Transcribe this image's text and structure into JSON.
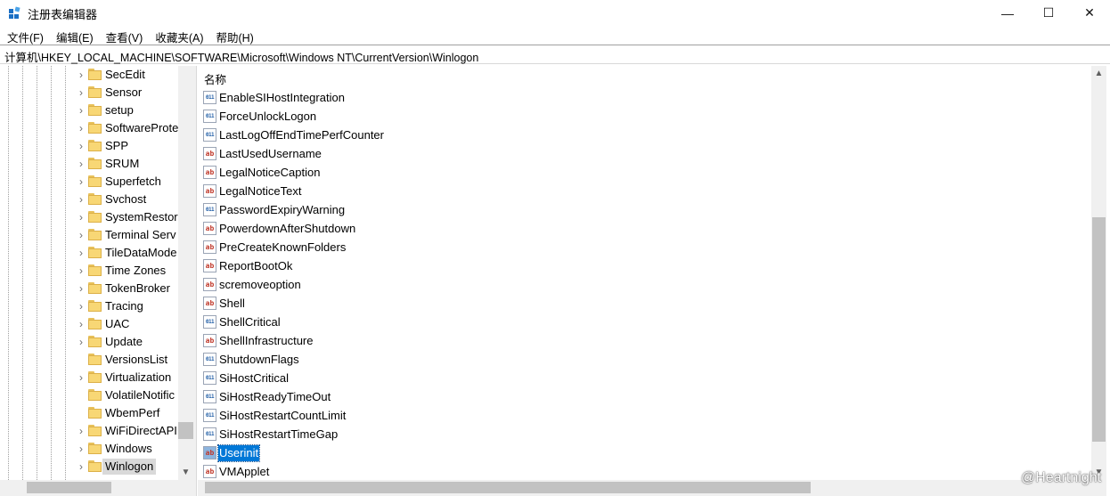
{
  "window": {
    "title": "注册表编辑器",
    "minimize": "—",
    "maximize": "☐",
    "close": "✕"
  },
  "menu": [
    "文件(F)",
    "编辑(E)",
    "查看(V)",
    "收藏夹(A)",
    "帮助(H)"
  ],
  "address": "计算机\\HKEY_LOCAL_MACHINE\\SOFTWARE\\Microsoft\\Windows NT\\CurrentVersion\\Winlogon",
  "tree": {
    "items": [
      {
        "label": "SecEdit",
        "expandable": true
      },
      {
        "label": "Sensor",
        "expandable": true
      },
      {
        "label": "setup",
        "expandable": true
      },
      {
        "label": "SoftwareProte",
        "expandable": true
      },
      {
        "label": "SPP",
        "expandable": true
      },
      {
        "label": "SRUM",
        "expandable": true
      },
      {
        "label": "Superfetch",
        "expandable": true
      },
      {
        "label": "Svchost",
        "expandable": true
      },
      {
        "label": "SystemRestor",
        "expandable": true
      },
      {
        "label": "Terminal Serv",
        "expandable": true
      },
      {
        "label": "TileDataMode",
        "expandable": true
      },
      {
        "label": "Time Zones",
        "expandable": true
      },
      {
        "label": "TokenBroker",
        "expandable": true
      },
      {
        "label": "Tracing",
        "expandable": true
      },
      {
        "label": "UAC",
        "expandable": true
      },
      {
        "label": "Update",
        "expandable": true
      },
      {
        "label": "VersionsList",
        "expandable": false
      },
      {
        "label": "Virtualization",
        "expandable": true
      },
      {
        "label": "VolatileNotific",
        "expandable": false
      },
      {
        "label": "WbemPerf",
        "expandable": false
      },
      {
        "label": "WiFiDirectAPI",
        "expandable": true
      },
      {
        "label": "Windows",
        "expandable": true
      },
      {
        "label": "Winlogon",
        "expandable": true,
        "selected": true
      }
    ],
    "chevron": "›"
  },
  "values": {
    "column_name": "名称",
    "rows": [
      {
        "name": "EnableSIHostIntegration",
        "type": "dword"
      },
      {
        "name": "ForceUnlockLogon",
        "type": "dword"
      },
      {
        "name": "LastLogOffEndTimePerfCounter",
        "type": "dword"
      },
      {
        "name": "LastUsedUsername",
        "type": "sz"
      },
      {
        "name": "LegalNoticeCaption",
        "type": "sz"
      },
      {
        "name": "LegalNoticeText",
        "type": "sz"
      },
      {
        "name": "PasswordExpiryWarning",
        "type": "dword"
      },
      {
        "name": "PowerdownAfterShutdown",
        "type": "sz"
      },
      {
        "name": "PreCreateKnownFolders",
        "type": "sz"
      },
      {
        "name": "ReportBootOk",
        "type": "sz"
      },
      {
        "name": "scremoveoption",
        "type": "sz"
      },
      {
        "name": "Shell",
        "type": "sz"
      },
      {
        "name": "ShellCritical",
        "type": "dword"
      },
      {
        "name": "ShellInfrastructure",
        "type": "sz"
      },
      {
        "name": "ShutdownFlags",
        "type": "dword"
      },
      {
        "name": "SiHostCritical",
        "type": "dword"
      },
      {
        "name": "SiHostReadyTimeOut",
        "type": "dword"
      },
      {
        "name": "SiHostRestartCountLimit",
        "type": "dword"
      },
      {
        "name": "SiHostRestartTimeGap",
        "type": "dword"
      },
      {
        "name": "Userinit",
        "type": "sz",
        "selected": true
      },
      {
        "name": "VMApplet",
        "type": "sz"
      }
    ],
    "icon_sz": "ab",
    "icon_dword": "011"
  },
  "scroll": {
    "up": "▲",
    "down": "▼"
  },
  "watermark": "@Heartnight"
}
